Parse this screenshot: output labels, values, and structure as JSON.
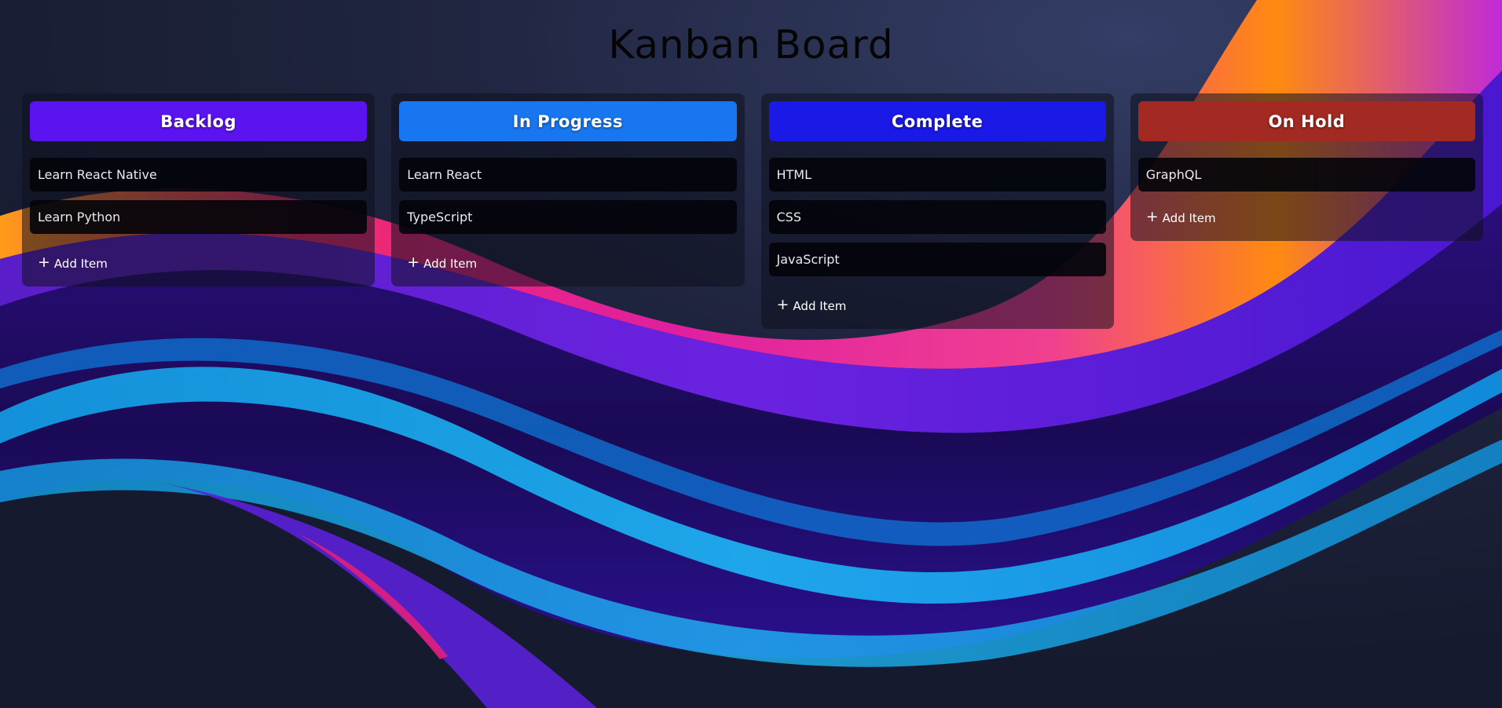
{
  "title": "Kanban Board",
  "columns": [
    {
      "title": "Backlog",
      "color": "#5b14ef",
      "items": [
        "Learn React Native",
        "Learn Python"
      ],
      "add_label": "Add Item"
    },
    {
      "title": "In Progress",
      "color": "#1877f0",
      "items": [
        "Learn React",
        "TypeScript"
      ],
      "add_label": "Add Item"
    },
    {
      "title": "Complete",
      "color": "#1a19e6",
      "items": [
        "HTML",
        "CSS",
        "JavaScript"
      ],
      "add_label": "Add Item"
    },
    {
      "title": "On Hold",
      "color": "#a32a22",
      "items": [
        "GraphQL"
      ],
      "add_label": "Add Item"
    }
  ],
  "icons": {
    "add": "plus-icon"
  }
}
